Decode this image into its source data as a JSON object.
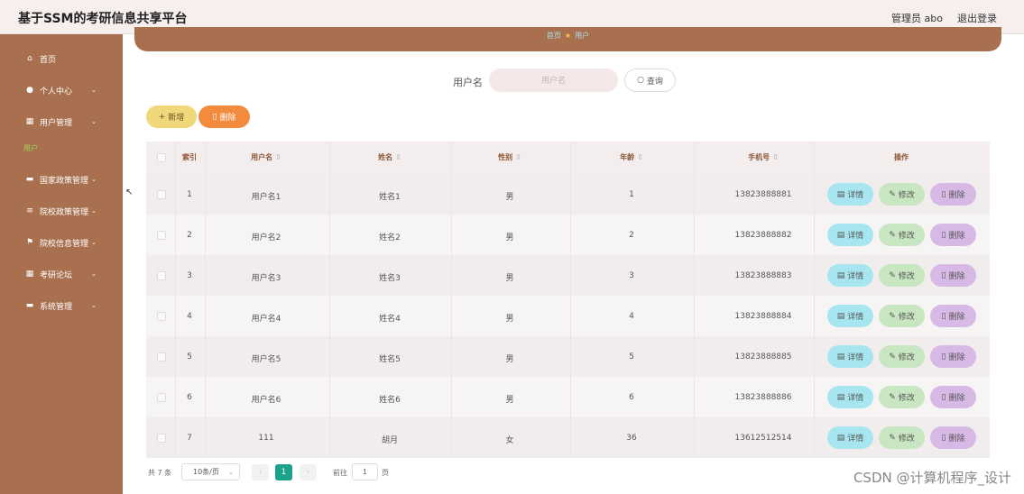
{
  "header": {
    "title": "基于SSM的考研信息共享平台",
    "user": "管理员 abo",
    "logout": "退出登录"
  },
  "sidebar": {
    "items": [
      {
        "label": "首页",
        "icon": "home-icon",
        "glyph": "⌂",
        "chev": false
      },
      {
        "label": "个人中心",
        "icon": "user-icon",
        "glyph": "●",
        "chev": true
      },
      {
        "label": "用户管理",
        "icon": "grid-icon",
        "glyph": "▦",
        "chev": true
      },
      {
        "label": "国家政策管理",
        "icon": "doc-icon",
        "glyph": "▬",
        "chev": true
      },
      {
        "label": "院校政策管理",
        "icon": "list-icon",
        "glyph": "≡",
        "chev": true
      },
      {
        "label": "院校信息管理",
        "icon": "flag-icon",
        "glyph": "⚑",
        "chev": true
      },
      {
        "label": "考研论坛",
        "icon": "grid-icon",
        "glyph": "▦",
        "chev": true
      },
      {
        "label": "系统管理",
        "icon": "chat-icon",
        "glyph": "▬",
        "chev": true
      }
    ],
    "sub": "用户"
  },
  "breadcrumb": {
    "home": "首页",
    "current": "用户"
  },
  "search": {
    "label": "用户名",
    "placeholder": "用户名",
    "button": "查询"
  },
  "toolbar": {
    "add": "新增",
    "delete": "删除"
  },
  "table": {
    "headers": [
      "索引",
      "用户名",
      "姓名",
      "性别",
      "年龄",
      "手机号",
      "操作"
    ],
    "rows": [
      {
        "index": "1",
        "username": "用户名1",
        "name": "姓名1",
        "gender": "男",
        "age": "1",
        "phone": "13823888881"
      },
      {
        "index": "2",
        "username": "用户名2",
        "name": "姓名2",
        "gender": "男",
        "age": "2",
        "phone": "13823888882"
      },
      {
        "index": "3",
        "username": "用户名3",
        "name": "姓名3",
        "gender": "男",
        "age": "3",
        "phone": "13823888883"
      },
      {
        "index": "4",
        "username": "用户名4",
        "name": "姓名4",
        "gender": "男",
        "age": "4",
        "phone": "13823888884"
      },
      {
        "index": "5",
        "username": "用户名5",
        "name": "姓名5",
        "gender": "男",
        "age": "5",
        "phone": "13823888885"
      },
      {
        "index": "6",
        "username": "用户名6",
        "name": "姓名6",
        "gender": "男",
        "age": "6",
        "phone": "13823888886"
      },
      {
        "index": "7",
        "username": "111",
        "name": "胡月",
        "gender": "女",
        "age": "36",
        "phone": "13612512514"
      }
    ],
    "actions": {
      "detail": "详情",
      "edit": "修改",
      "delete": "删除"
    }
  },
  "pagination": {
    "total": "共 7 条",
    "page_size": "10条/页",
    "current": "1",
    "goto": "前往",
    "goto_value": "1",
    "unit": "页"
  },
  "watermark": "CSDN @计算机程序_设计",
  "colors": {
    "sidebar": "#a8704e",
    "accent": "#1aa38a",
    "add": "#f0d77a",
    "delete": "#f28b3d"
  }
}
